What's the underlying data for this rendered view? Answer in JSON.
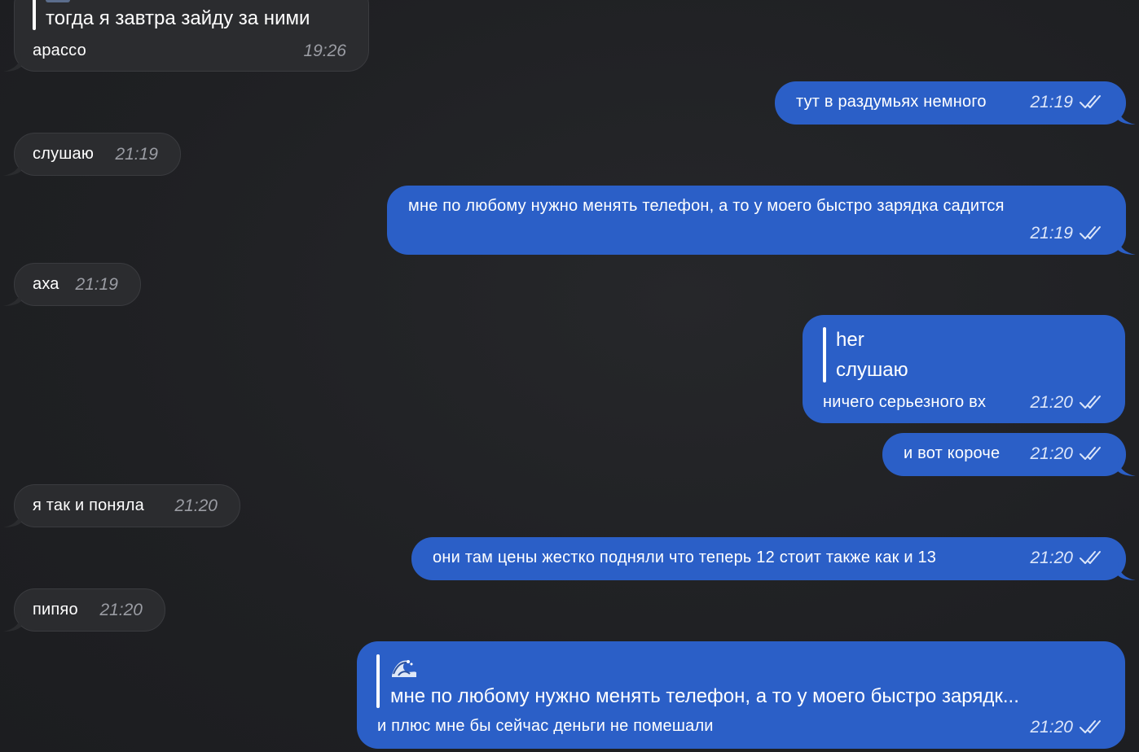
{
  "messages": [
    {
      "id": "m1",
      "direction": "incoming",
      "quote_text": "тогда я завтра зайду за ними",
      "text": "арассо",
      "time": "19:26"
    },
    {
      "id": "m2",
      "direction": "outgoing",
      "text": "тут в раздумьях немного",
      "time": "21:19"
    },
    {
      "id": "m3",
      "direction": "incoming",
      "text": "слушаю",
      "time": "21:19"
    },
    {
      "id": "m4",
      "direction": "outgoing",
      "text": "мне по любому нужно менять телефон, а то у моего быстро зарядка садится",
      "time": "21:19"
    },
    {
      "id": "m5",
      "direction": "incoming",
      "text": "аха",
      "time": "21:19"
    },
    {
      "id": "m6",
      "direction": "outgoing",
      "quote_author": "her",
      "quote_text": "слушаю",
      "text": "ничего серьезного вх",
      "time": "21:20"
    },
    {
      "id": "m7",
      "direction": "outgoing",
      "text": "и вот короче",
      "time": "21:20"
    },
    {
      "id": "m8",
      "direction": "incoming",
      "text": "я так и поняла",
      "time": "21:20"
    },
    {
      "id": "m9",
      "direction": "outgoing",
      "text": "они там цены жестко подняли что теперь 12 стоит также как и 13",
      "time": "21:20"
    },
    {
      "id": "m10",
      "direction": "incoming",
      "text": "пипяо",
      "time": "21:20"
    },
    {
      "id": "m11",
      "direction": "outgoing",
      "quote_author_icon": "wave-emoji",
      "quote_text": "мне по любому нужно менять телефон, а то у моего быстро зарядк...",
      "text": "и плюс мне бы сейчас деньги не помешали",
      "time": "21:20"
    }
  ],
  "colors": {
    "background": "#1f2023",
    "incoming_bubble": "#2b2c2f",
    "outgoing_bubble": "#2b5fc7",
    "text": "#ffffff",
    "incoming_time": "#9a9ca3"
  },
  "icons": {
    "read_receipt": "double-check-icon",
    "reply_thumbnail": "wave-emoji"
  }
}
